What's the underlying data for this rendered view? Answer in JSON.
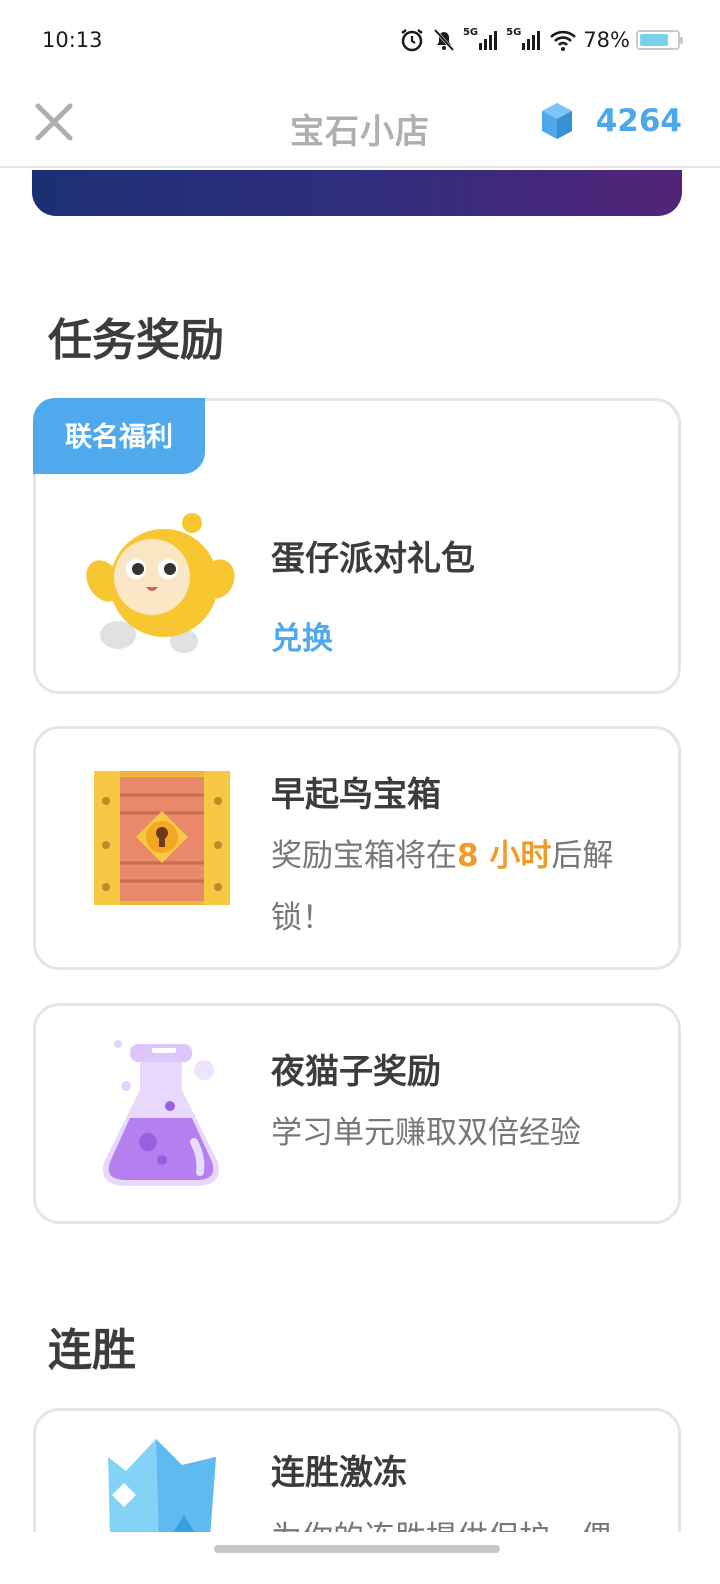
{
  "status_bar": {
    "time": "10:13",
    "network_1": "5G",
    "network_2": "5G",
    "battery": "78%",
    "battery_fraction": 0.78
  },
  "header": {
    "title": "宝石小店",
    "gem_count": "4264",
    "close_icon": "close-icon",
    "gem_icon": "gem-icon"
  },
  "section_rewards": {
    "title": "任务奖励",
    "items": [
      {
        "tag": "联名福利",
        "title": "蛋仔派对礼包",
        "action": "兑换",
        "icon": "eggy-mascot-icon"
      },
      {
        "title": "早起鸟宝箱",
        "desc_prefix": "奖励宝箱将在",
        "desc_highlight": "8 小时",
        "desc_suffix": "后解锁！",
        "icon": "treasure-chest-icon"
      },
      {
        "title": "夜猫子奖励",
        "desc": "学习单元赚取双倍经验",
        "icon": "potion-flask-icon"
      }
    ]
  },
  "section_streak": {
    "title": "连胜",
    "items": [
      {
        "title": "连胜激冻",
        "desc": "为你的连胜提供保护，偶",
        "icon": "streak-freeze-icon"
      }
    ]
  },
  "colors": {
    "accent_blue": "#4fa9ec",
    "highlight_orange": "#f29a2a",
    "banner_start": "#1c2f74",
    "banner_end": "#532478"
  }
}
